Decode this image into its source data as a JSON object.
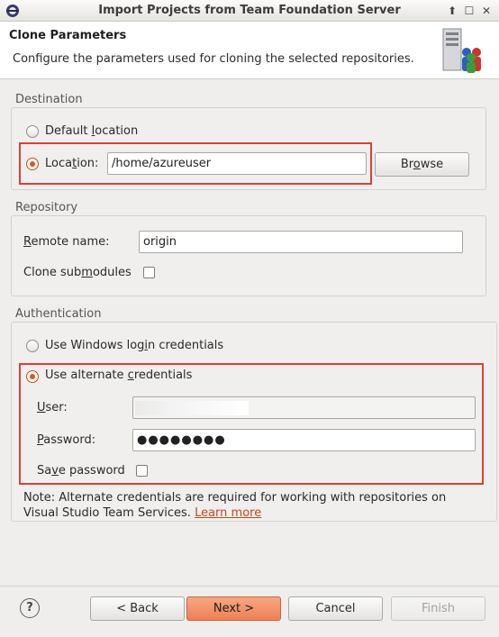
{
  "window": {
    "title": "Import Projects from Team Foundation Server"
  },
  "header": {
    "title": "Clone Parameters",
    "description": "Configure the parameters used for cloning the selected repositories."
  },
  "destination": {
    "group_label": "Destination",
    "default_option": "Default location",
    "location_option": "Location:",
    "location_value": "/home/azureuser",
    "browse_label": "Browse"
  },
  "repository": {
    "group_label": "Repository",
    "remote_name_label": "Remote name:",
    "remote_name_value": "origin",
    "clone_submodules_label": "Clone submodules"
  },
  "authentication": {
    "group_label": "Authentication",
    "windows_option": "Use Windows login credentials",
    "alternate_option": "Use alternate credentials",
    "user_label": "User:",
    "password_label": "Password:",
    "password_value": "●●●●●●●●",
    "save_password_label": "Save password",
    "note": "Note: Alternate credentials are required for working with repositories on Visual Studio Team Services.",
    "learn_more": "Learn more"
  },
  "footer": {
    "help_glyph": "?",
    "back_label": "< Back",
    "next_label": "Next >",
    "cancel_label": "Cancel",
    "finish_label": "Finish"
  },
  "colors": {
    "accent": "#e0541f",
    "highlight": "#d9413a",
    "link": "#c5461b"
  }
}
